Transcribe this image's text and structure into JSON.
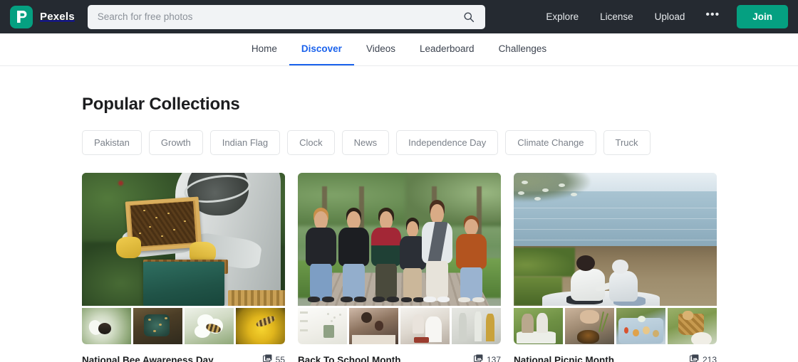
{
  "header": {
    "logo_icon": "pexels-p-logo-icon",
    "brand_name": "Pexels",
    "brand_color": "#05a081",
    "search": {
      "placeholder": "Search for free photos",
      "value": "",
      "icon": "search-icon"
    },
    "links": [
      {
        "label": "Explore"
      },
      {
        "label": "License"
      },
      {
        "label": "Upload"
      }
    ],
    "more_icon": "ellipsis-icon",
    "more_label": "•••",
    "join_label": "Join",
    "background_color": "#252a31"
  },
  "subnav": {
    "active_color": "#1a62ec",
    "items": [
      {
        "label": "Home",
        "active": false
      },
      {
        "label": "Discover",
        "active": true
      },
      {
        "label": "Videos",
        "active": false
      },
      {
        "label": "Leaderboard",
        "active": false
      },
      {
        "label": "Challenges",
        "active": false
      }
    ]
  },
  "main": {
    "title": "Popular Collections",
    "chips": [
      {
        "label": "Pakistan"
      },
      {
        "label": "Growth"
      },
      {
        "label": "Indian Flag"
      },
      {
        "label": "Clock"
      },
      {
        "label": "News"
      },
      {
        "label": "Independence Day"
      },
      {
        "label": "Climate Change"
      },
      {
        "label": "Truck"
      }
    ],
    "collections": [
      {
        "title": "National Bee Awareness Day",
        "count": "55",
        "count_icon": "photo-stack-icon",
        "hero_alt": "beekeeper-holding-honeycomb-frame",
        "thumbs": [
          "bee-on-white-flower",
          "beehive-closeup",
          "bee-on-white-blossom",
          "bee-on-yellow-dandelion"
        ]
      },
      {
        "title": "Back To School Month",
        "count": "137",
        "count_icon": "photo-stack-icon",
        "hero_alt": "group-of-teenagers-walking-on-park-boardwalk",
        "thumbs": [
          "bright-classroom-interior",
          "adults-and-child-drawing",
          "mother-and-child-with-book",
          "students-standing-by-wall"
        ]
      },
      {
        "title": "National Picnic Month",
        "count": "213",
        "count_icon": "photo-stack-icon",
        "hero_alt": "couple-having-picnic-by-the-lake",
        "thumbs": [
          "couple-on-picnic-blanket",
          "hands-with-bowl-of-fruit",
          "blue-picnic-blanket-spread",
          "picnic-basket-with-bread"
        ]
      }
    ]
  }
}
